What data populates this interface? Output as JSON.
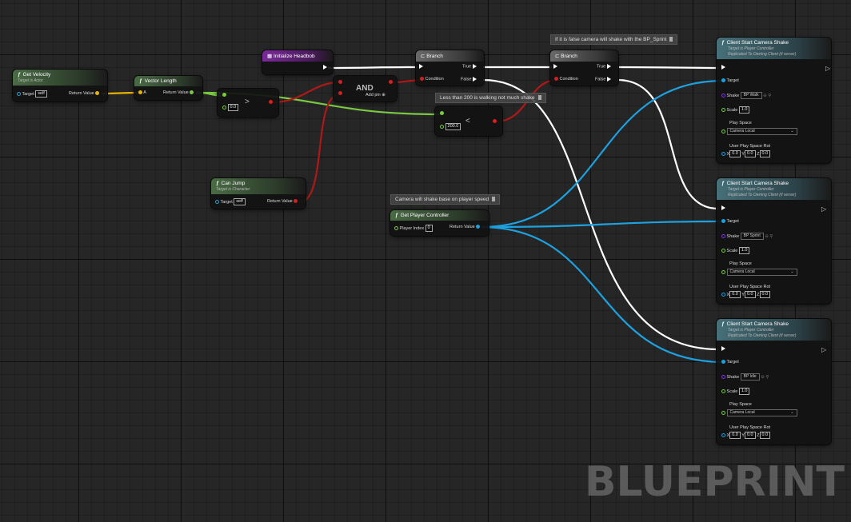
{
  "colors": {
    "object_pin": "#1da1e0",
    "vector_pin": "#e5b300",
    "float_pin": "#7ac943",
    "bool_pin": "#d42020",
    "class_pin": "#7a3ad8",
    "exec_wire": "#ffffff",
    "grid_bg": "#262626"
  },
  "comments": {
    "c1": "If it is false camera will shake with the BP_Sprint",
    "c2": "Less than 200 is walking not much shake",
    "c3": "Camera will shake base on player speed"
  },
  "get_velocity": {
    "title": "Get Velocity",
    "subtitle": "Target is Actor",
    "target": "Target",
    "target_value": "self",
    "ret": "Return Value"
  },
  "vector_length": {
    "title": "Vector Length",
    "a": "A",
    "ret": "Return Value"
  },
  "greater": {
    "op": ">",
    "value": "0.0"
  },
  "init_headbob": {
    "title": "Initialize Headbob"
  },
  "and_node": {
    "title": "AND",
    "add_pin": "Add pin"
  },
  "branch1": {
    "title": "Branch",
    "condition": "Condition",
    "true": "True",
    "false": "False"
  },
  "branch2": {
    "title": "Branch",
    "condition": "Condition",
    "true": "True",
    "false": "False"
  },
  "less": {
    "op": "<",
    "value": "200.0"
  },
  "can_jump": {
    "title": "Can Jump",
    "subtitle": "Target is Character",
    "target": "Target",
    "target_value": "self",
    "ret": "Return Value"
  },
  "get_pc": {
    "title": "Get Player Controller",
    "player_index": "Player Index",
    "index_value": "0",
    "ret": "Return Value"
  },
  "shake_nodes": [
    {
      "title": "Client Start Camera Shake",
      "sub1": "Target is Player Controller",
      "sub2": "Replicated To Owning Client (if server)",
      "target": "Target",
      "shake": "Shake",
      "shake_value": "BP Walk",
      "scale": "Scale",
      "scale_value": "1.0",
      "play_space": "Play Space",
      "play_space_value": "Camera Local",
      "rot": "User Play Space Rot",
      "x": "0.0",
      "y": "0.0",
      "z": "0.0"
    },
    {
      "title": "Client Start Camera Shake",
      "sub1": "Target is Player Controller",
      "sub2": "Replicated To Owning Client (if server)",
      "target": "Target",
      "shake": "Shake",
      "shake_value": "BP Sprint",
      "scale": "Scale",
      "scale_value": "1.0",
      "play_space": "Play Space",
      "play_space_value": "Camera Local",
      "rot": "User Play Space Rot",
      "x": "0.0",
      "y": "0.0",
      "z": "0.0"
    },
    {
      "title": "Client Start Camera Shake",
      "sub1": "Target is Player Controller",
      "sub2": "Replicated To Owning Client (if server)",
      "target": "Target",
      "shake": "Shake",
      "shake_value": "BP Idle",
      "scale": "Scale",
      "scale_value": "1.0",
      "play_space": "Play Space",
      "play_space_value": "Camera Local",
      "rot": "User Play Space Rot",
      "x": "0.0",
      "y": "0.0",
      "z": "0.0"
    }
  ],
  "axis_labels": {
    "x": "X",
    "y": "Y",
    "z": "Z"
  },
  "watermark": "BLUEPRINT"
}
